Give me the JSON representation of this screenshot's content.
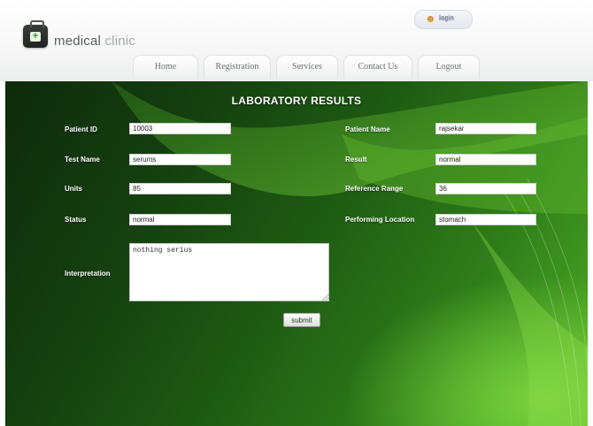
{
  "brand": {
    "word1": "medical",
    "word2": "clinic"
  },
  "login": {
    "label": "login"
  },
  "nav": {
    "items": [
      {
        "label": "Home"
      },
      {
        "label": "Registration"
      },
      {
        "label": "Services"
      },
      {
        "label": "Contact Us"
      },
      {
        "label": "Logout"
      }
    ]
  },
  "page": {
    "title": "LABORATORY RESULTS"
  },
  "form": {
    "patient_id": {
      "label": "Patient ID",
      "value": "10003"
    },
    "patient_name": {
      "label": "Patient Name",
      "value": "rajsekar"
    },
    "test_name": {
      "label": "Test Name",
      "value": "serums"
    },
    "result": {
      "label": "Result",
      "value": "normal"
    },
    "units": {
      "label": "Units",
      "value": "85"
    },
    "reference": {
      "label": "Reference Range",
      "value": "36"
    },
    "status": {
      "label": "Status",
      "value": "normal"
    },
    "location": {
      "label": "Performing Location",
      "value": "stomach"
    },
    "interpretation": {
      "label": "Interpretation",
      "value": "nothing serius"
    },
    "submit_label": "submit"
  },
  "colors": {
    "panel_dark": "#0e2b0c",
    "panel_light": "#7bd33e",
    "nav_text": "#6f7470"
  },
  "icons": {
    "logo": "medical-kit-icon",
    "login": "user-icon",
    "resize": "resize-grip-icon"
  }
}
